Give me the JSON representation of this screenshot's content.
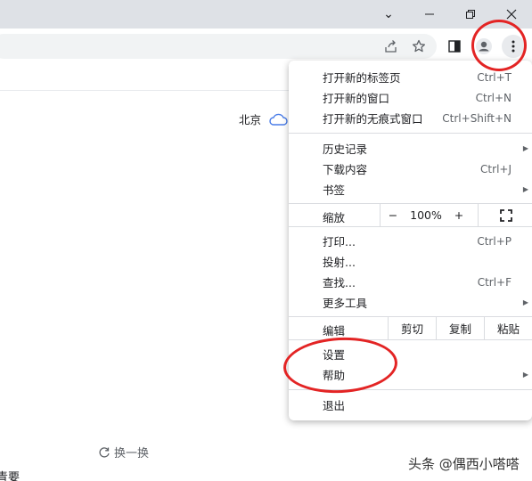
{
  "page": {
    "weather_city": "北京",
    "refresh_label": "换一换",
    "cut_text": "青要",
    "watermark": "头条 @偶西小嗒嗒"
  },
  "window_controls": {
    "tab_search": "⌄",
    "minimize": "—",
    "restore": "❐",
    "close": "✕"
  },
  "menu": {
    "new_tab": {
      "label": "打开新的标签页",
      "shortcut": "Ctrl+T"
    },
    "new_window": {
      "label": "打开新的窗口",
      "shortcut": "Ctrl+N"
    },
    "incognito": {
      "label": "打开新的无痕式窗口",
      "shortcut": "Ctrl+Shift+N"
    },
    "history": {
      "label": "历史记录"
    },
    "downloads": {
      "label": "下载内容",
      "shortcut": "Ctrl+J"
    },
    "bookmarks": {
      "label": "书签"
    },
    "zoom": {
      "label": "缩放",
      "minus": "−",
      "value": "100%",
      "plus": "+"
    },
    "print": {
      "label": "打印...",
      "shortcut": "Ctrl+P"
    },
    "cast": {
      "label": "投射..."
    },
    "find": {
      "label": "查找...",
      "shortcut": "Ctrl+F"
    },
    "more_tools": {
      "label": "更多工具"
    },
    "edit": {
      "label": "编辑",
      "cut": "剪切",
      "copy": "复制",
      "paste": "粘贴"
    },
    "settings": {
      "label": "设置"
    },
    "help": {
      "label": "帮助"
    },
    "exit": {
      "label": "退出"
    }
  },
  "colors": {
    "annotation": "#e32424",
    "titlebar": "#dee1e6",
    "omnibox": "#f1f3f4"
  }
}
